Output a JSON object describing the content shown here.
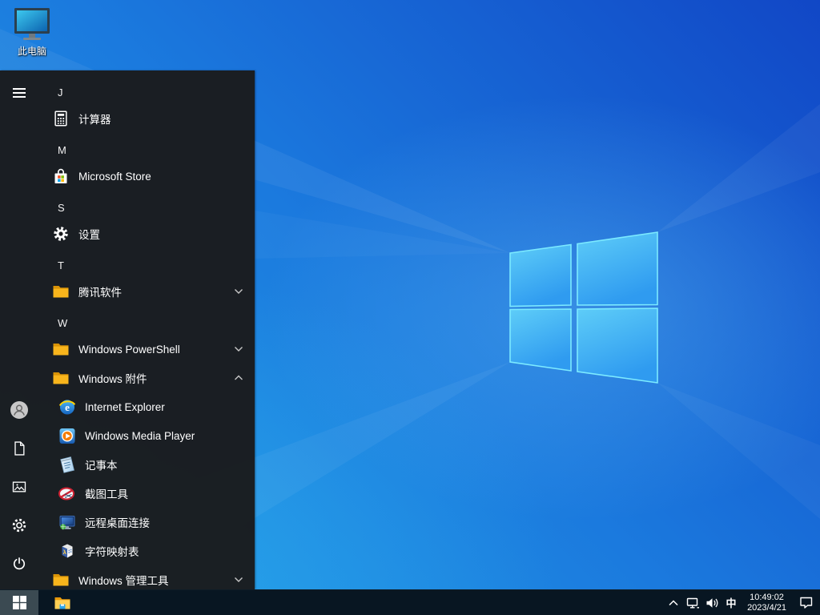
{
  "colors": {
    "wallpaper_deep_blue": "#1147c6",
    "wallpaper_bright_blue": "#23a0e6",
    "logo_pane_blue": "#3fb6f4",
    "logo_edge_cyan": "#7ceaff",
    "start_menu_bg": "#1a1c1f",
    "taskbar_bg": "#081622",
    "start_button_highlight": "#3b4a52",
    "folder_yellow": "#f7b118",
    "store_red": "#f25022",
    "store_green": "#7fba00",
    "store_blue": "#00a4ef",
    "store_yellow": "#ffb900"
  },
  "desktop": {
    "icons": [
      {
        "label": "此电脑",
        "icon": "computer-icon"
      }
    ]
  },
  "start_menu": {
    "rail": [
      {
        "name": "menu-expand",
        "icon": "hamburger-icon"
      },
      {
        "name": "user",
        "icon": "user-icon"
      },
      {
        "name": "documents",
        "icon": "document-icon"
      },
      {
        "name": "pictures",
        "icon": "pictures-icon"
      },
      {
        "name": "settings",
        "icon": "gear-icon"
      },
      {
        "name": "power",
        "icon": "power-icon"
      }
    ],
    "rows": [
      {
        "type": "section-header",
        "label": "J"
      },
      {
        "type": "app",
        "label": "计算器",
        "icon": "calculator-icon"
      },
      {
        "type": "section-header",
        "label": "M"
      },
      {
        "type": "app",
        "label": "Microsoft Store",
        "icon": "store-icon"
      },
      {
        "type": "section-header",
        "label": "S"
      },
      {
        "type": "app",
        "label": "设置",
        "icon": "settings-icon"
      },
      {
        "type": "section-header",
        "label": "T"
      },
      {
        "type": "folder",
        "label": "腾讯软件",
        "icon": "folder-icon",
        "state": "collapsed"
      },
      {
        "type": "section-header",
        "label": "W"
      },
      {
        "type": "folder",
        "label": "Windows PowerShell",
        "icon": "folder-icon",
        "state": "collapsed"
      },
      {
        "type": "folder",
        "label": "Windows 附件",
        "icon": "folder-icon",
        "state": "expanded"
      },
      {
        "type": "app",
        "label": "Internet Explorer",
        "icon": "internet-explorer-icon",
        "child": true
      },
      {
        "type": "app",
        "label": "Windows Media Player",
        "icon": "media-player-icon",
        "child": true
      },
      {
        "type": "app",
        "label": "记事本",
        "icon": "notepad-icon",
        "child": true
      },
      {
        "type": "app",
        "label": "截图工具",
        "icon": "snipping-tool-icon",
        "child": true
      },
      {
        "type": "app",
        "label": "远程桌面连接",
        "icon": "remote-desktop-icon",
        "child": true
      },
      {
        "type": "app",
        "label": "字符映射表",
        "icon": "character-map-icon",
        "child": true
      },
      {
        "type": "folder",
        "label": "Windows 管理工具",
        "icon": "folder-icon",
        "state": "collapsed"
      }
    ]
  },
  "taskbar": {
    "tray": {
      "ime_label": "中",
      "time": "10:49:02",
      "date": "2023/4/21"
    }
  }
}
